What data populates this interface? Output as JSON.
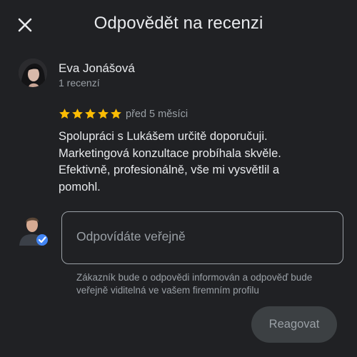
{
  "header": {
    "title": "Odpovědět na recenzi",
    "close_icon": "close-icon"
  },
  "review": {
    "author_name": "Eva Jonášová",
    "author_review_count": "1 recenzí",
    "rating": 5,
    "rating_max": 5,
    "star_color": "#fbbc04",
    "time": "před 5 měsíci",
    "text": "Spolupráci s Lukášem určitě doporučuji. Marketingová konzultace probíhala skvěle. Efektivně, profesionálně, vše mi vysvětlil a pomohl."
  },
  "reply": {
    "placeholder": "Odpovídáte veřejně",
    "value": "",
    "owner_badge_icon": "verified-check-icon",
    "notice": "Zákazník bude o odpovědi informován a odpověď bude veřejně viditelná ve vašem firemním profilu",
    "submit_label": "Reagovat"
  }
}
